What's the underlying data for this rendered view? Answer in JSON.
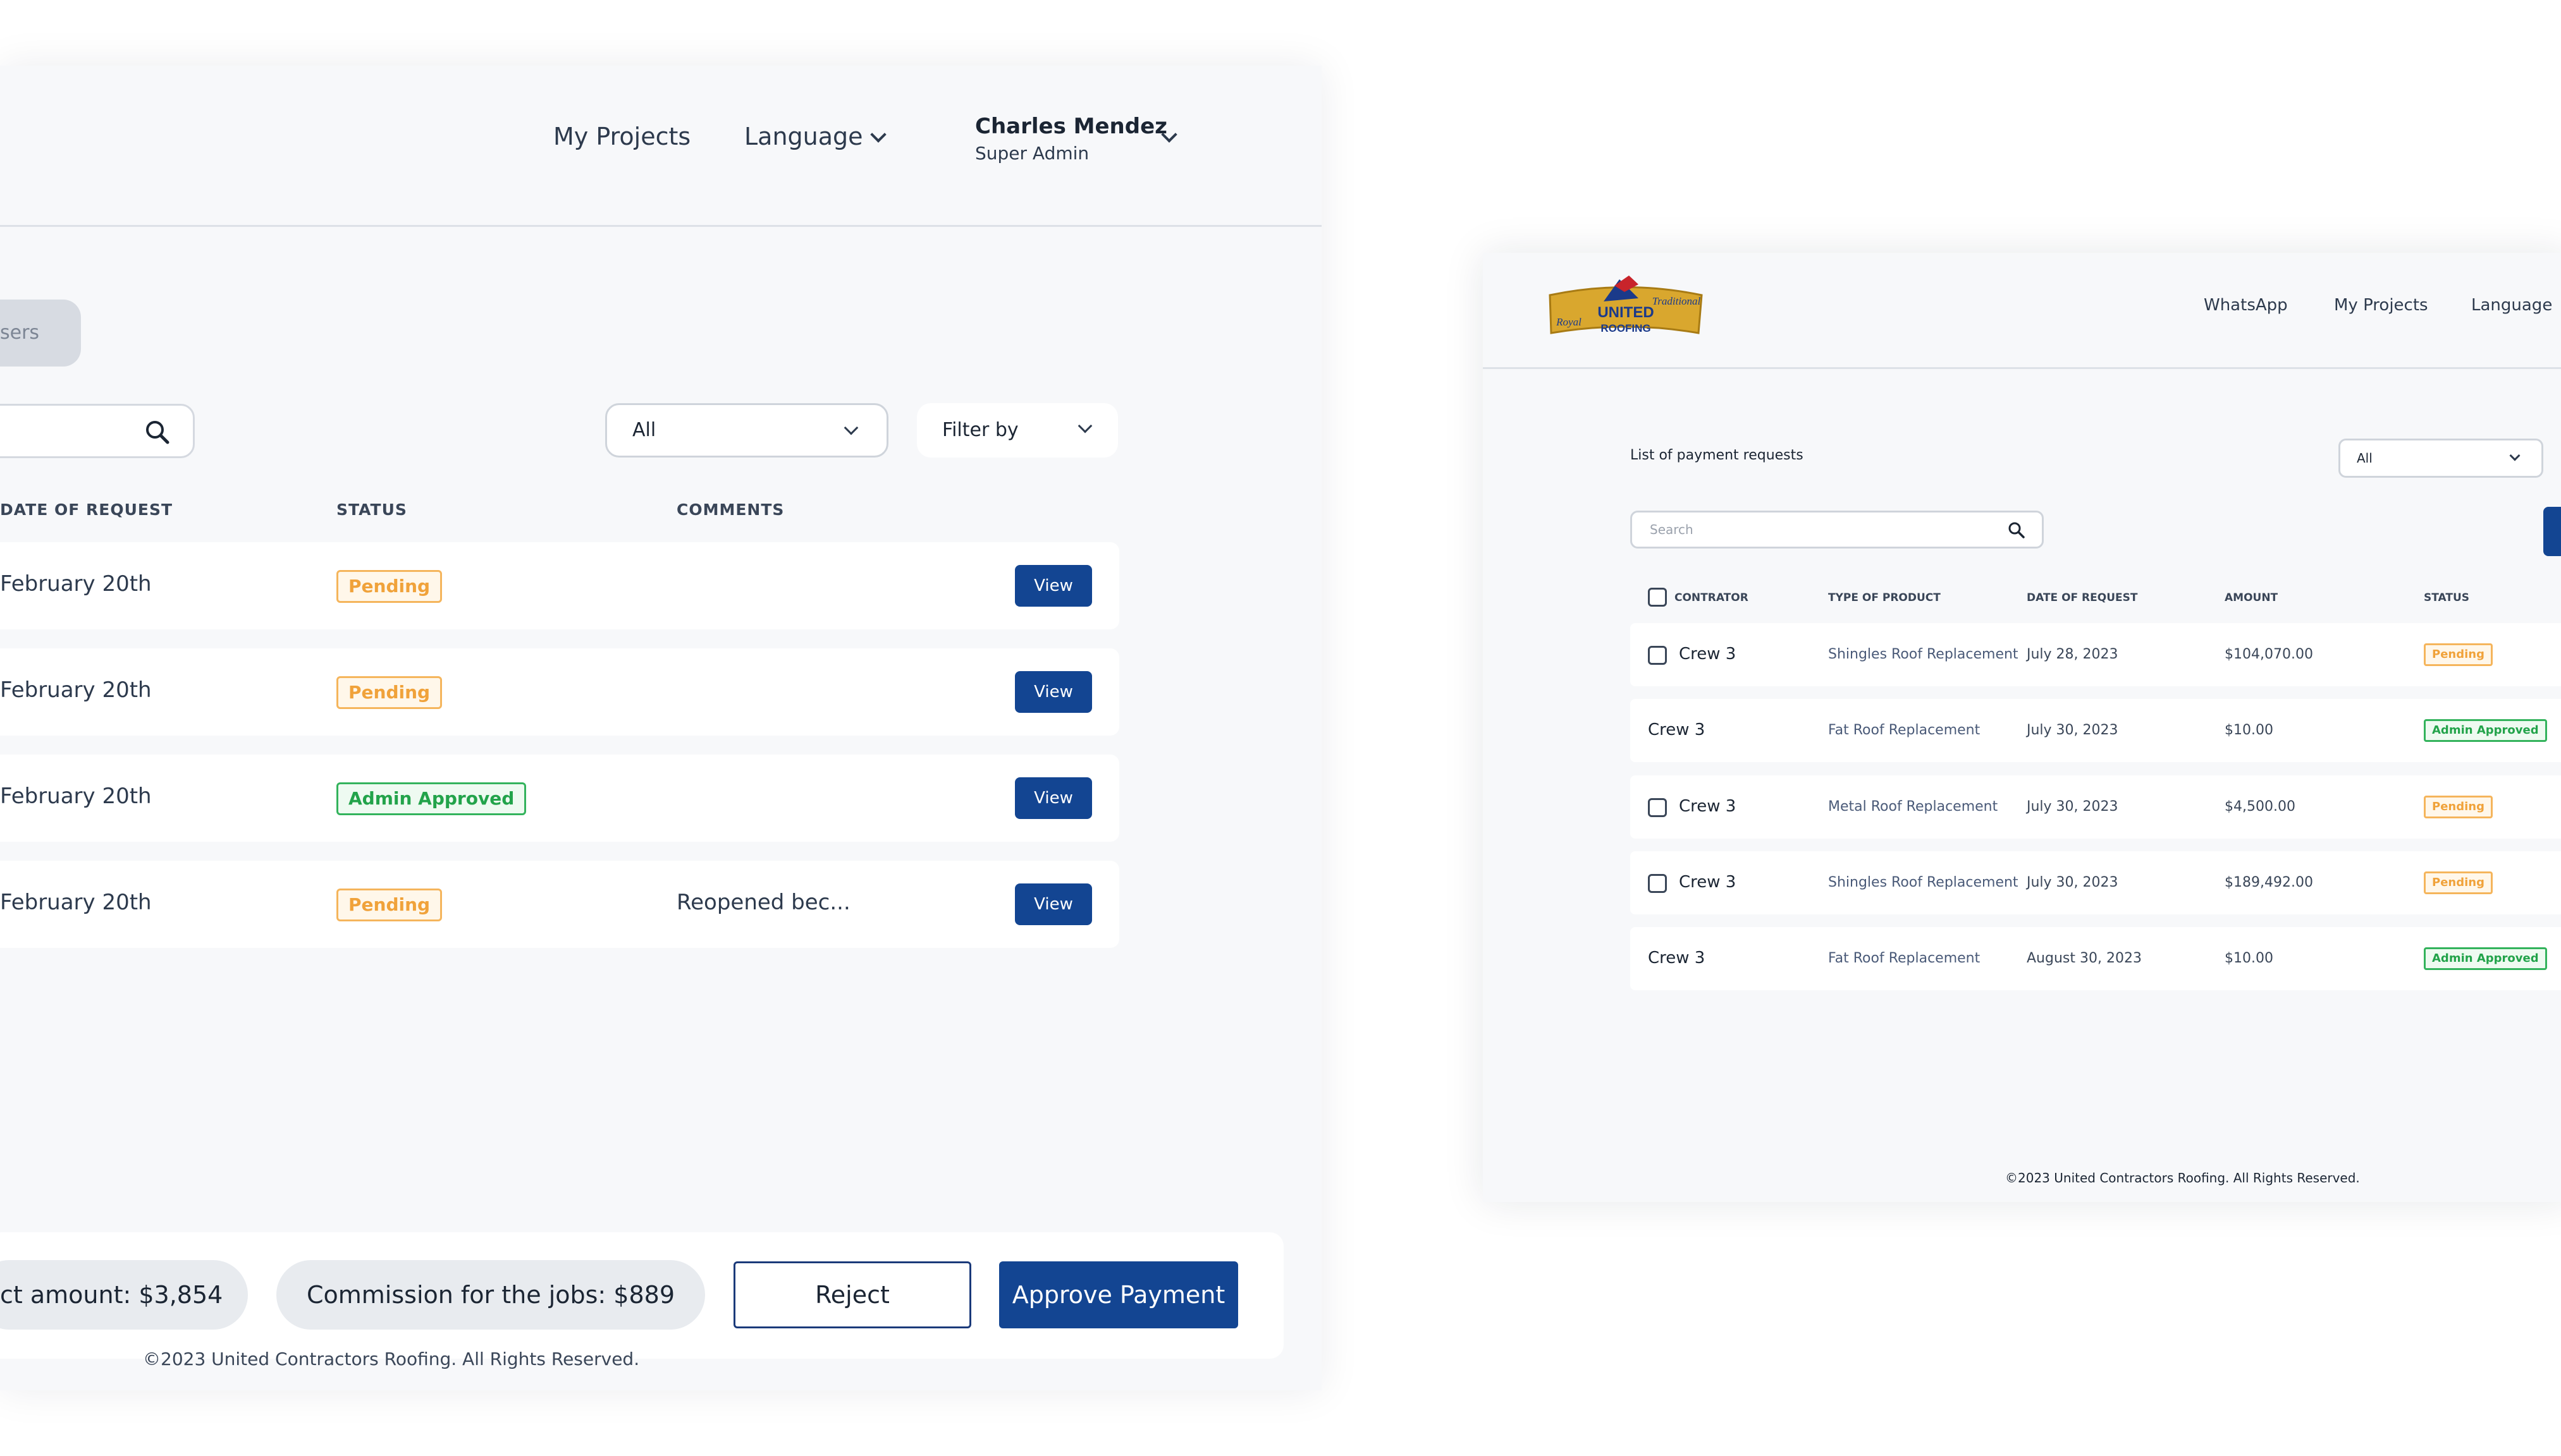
{
  "left": {
    "nav": {
      "my_projects": "My Projects",
      "language": "Language"
    },
    "user": {
      "name": "Charles Mendez",
      "role": "Super Admin"
    },
    "tab_partial": "sers",
    "select": {
      "value": "All"
    },
    "filter": {
      "label": "Filter by"
    },
    "columns": {
      "date": "DATE OF REQUEST",
      "status": "STATUS",
      "comments": "COMMENTS"
    },
    "rows": [
      {
        "date": "February 20th",
        "status": "Pending",
        "comment": "",
        "action": "View"
      },
      {
        "date": "February 20th",
        "status": "Pending",
        "comment": "",
        "action": "View"
      },
      {
        "date": "February 20th",
        "status": "Admin Approved",
        "comment": "",
        "action": "View"
      },
      {
        "date": "February 20th",
        "status": "Pending",
        "comment": "Reopened bec...",
        "action": "View"
      }
    ],
    "footer": {
      "amount": "ct amount: $3,854",
      "commission": "Commission for the jobs: $889",
      "reject": "Reject",
      "approve": "Approve Payment",
      "copyright": "©2023 United Contractors Roofing. All Rights Reserved."
    }
  },
  "right": {
    "nav": {
      "whatsapp": "WhatsApp",
      "my_projects": "My Projects",
      "language": "Language"
    },
    "logo": {
      "top": "UNITED",
      "bottom": "ROOFING",
      "left_script": "Royal",
      "right_script": "Traditional"
    },
    "title": "List of payment requests",
    "select": {
      "value": "All"
    },
    "search": {
      "placeholder": "Search"
    },
    "columns": {
      "contractor": "CONTRATOR",
      "product": "TYPE OF PRODUCT",
      "date": "DATE OF REQUEST",
      "amount": "AMOUNT",
      "status": "STATUS"
    },
    "rows": [
      {
        "contractor": "Crew 3",
        "product": "Shingles Roof Replacement",
        "date": "July 28, 2023",
        "amount": "$104,070.00",
        "status": "Pending"
      },
      {
        "contractor": "Crew 3",
        "product": "Fat Roof Replacement",
        "date": "July 30, 2023",
        "amount": "$10.00",
        "status": "Admin Approved"
      },
      {
        "contractor": "Crew 3",
        "product": "Metal Roof Replacement",
        "date": "July 30, 2023",
        "amount": "$4,500.00",
        "status": "Pending"
      },
      {
        "contractor": "Crew 3",
        "product": "Shingles Roof Replacement",
        "date": "July 30, 2023",
        "amount": "$189,492.00",
        "status": "Pending"
      },
      {
        "contractor": "Crew 3",
        "product": "Fat Roof Replacement",
        "date": "August 30, 2023",
        "amount": "$10.00",
        "status": "Admin Approved"
      }
    ],
    "copyright": "©2023 United Contractors Roofing. All Rights Reserved."
  },
  "colors": {
    "primary": "#134592",
    "pending": "#f0a23a",
    "approved": "#22a34a",
    "background": "#f7f8fa"
  }
}
